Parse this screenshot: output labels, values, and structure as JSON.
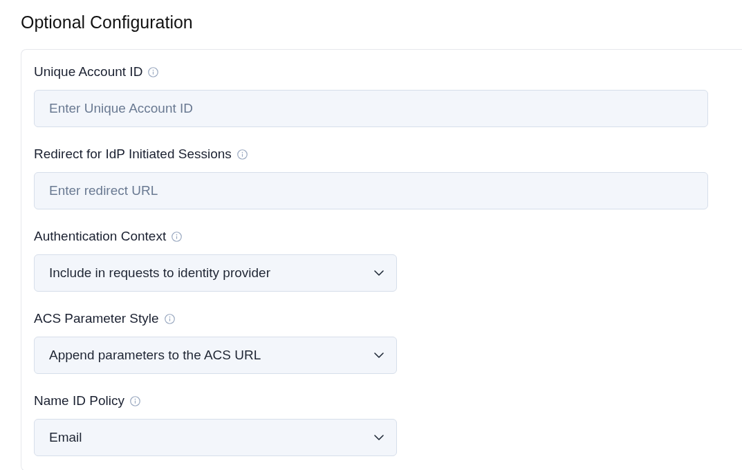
{
  "title": "Optional Configuration",
  "fields": [
    {
      "kind": "text",
      "label": "Unique Account ID",
      "placeholder": "Enter Unique Account ID"
    },
    {
      "kind": "text",
      "label": "Redirect for IdP Initiated Sessions",
      "placeholder": "Enter redirect URL"
    },
    {
      "kind": "select",
      "label": "Authentication Context",
      "value": "Include in requests to identity provider"
    },
    {
      "kind": "select",
      "label": "ACS Parameter Style",
      "value": "Append parameters to the ACS URL"
    },
    {
      "kind": "select",
      "label": "Name ID Policy",
      "value": "Email"
    }
  ]
}
